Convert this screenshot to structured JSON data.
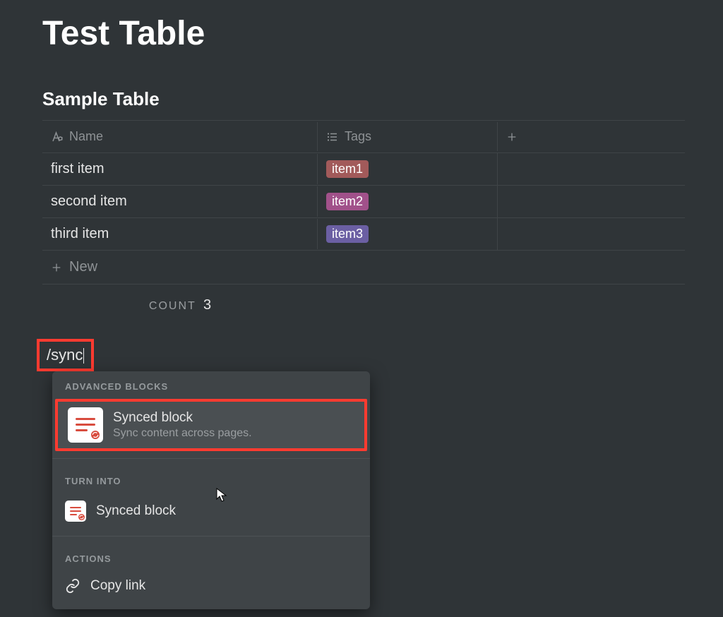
{
  "page": {
    "title": "Test Table"
  },
  "table": {
    "title": "Sample Table",
    "columns": {
      "name_label": "Name",
      "tags_label": "Tags"
    },
    "rows": [
      {
        "name": "first item",
        "tag": "item1",
        "tag_color": "red"
      },
      {
        "name": "second item",
        "tag": "item2",
        "tag_color": "pink"
      },
      {
        "name": "third item",
        "tag": "item3",
        "tag_color": "purple"
      }
    ],
    "new_label": "New",
    "count_label": "COUNT",
    "count_value": "3"
  },
  "slash": {
    "input_text": "/sync"
  },
  "popup": {
    "sections": {
      "advanced_label": "ADVANCED BLOCKS",
      "turn_into_label": "TURN INTO",
      "actions_label": "ACTIONS"
    },
    "advanced_item": {
      "title": "Synced block",
      "desc": "Sync content across pages."
    },
    "turn_into_item": {
      "title": "Synced block"
    },
    "action_item": {
      "title": "Copy link"
    }
  }
}
